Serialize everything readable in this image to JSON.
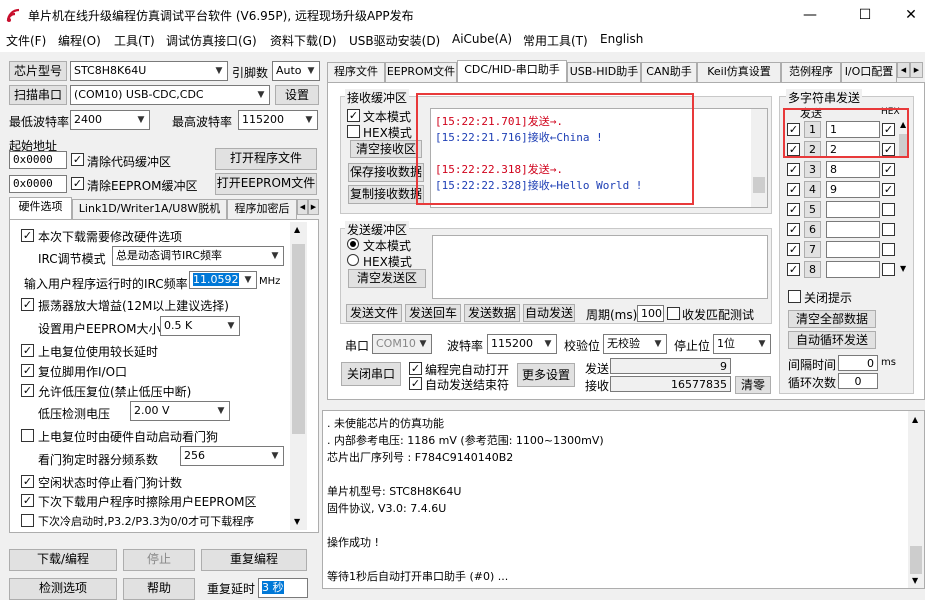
{
  "window": {
    "title": "单片机在线升级编程仿真调试平台软件 (V6.95P), 远程现场升级APP发布",
    "minimize": "—",
    "maximize": "☐",
    "close": "✕"
  },
  "menu": [
    "文件(F)",
    "编程(O)",
    "工具(T)",
    "调试仿真接口(G)",
    "资料下载(D)",
    "USB驱动安装(D)",
    "AiCube(A)",
    "常用工具(T)",
    "English"
  ],
  "left": {
    "chip_model_btn": "芯片型号",
    "chip_model": "STC8H8K64U",
    "pin_label": "引脚数",
    "pin_value": "Auto",
    "scan_port_btn": "扫描串口",
    "port_value": "(COM10) USB-CDC,CDC",
    "settings_btn": "设置",
    "min_baud_label": "最低波特率",
    "min_baud": "2400",
    "max_baud_label": "最高波特率",
    "max_baud": "115200",
    "start_addr_label": "起始地址",
    "addr1": "0x0000",
    "clear_code_buf": "清除代码缓冲区",
    "open_program_btn": "打开程序文件",
    "addr2": "0x0000",
    "clear_eeprom_buf": "清除EEPROM缓冲区",
    "open_eeprom_btn": "打开EEPROM文件",
    "tabs": [
      "硬件选项",
      "Link1D/Writer1A/U8W脱机",
      "程序加密后"
    ],
    "options": {
      "hw_change": "本次下载需要修改硬件选项",
      "irc_mode_label": "IRC调节模式",
      "irc_mode": "总是动态调节IRC频率",
      "irc_freq_label": "输入用户程序运行时的IRC频率",
      "irc_freq": "11.0592",
      "irc_unit": "MHz",
      "osc_gain": "振荡器放大增益(12M以上建议选择)",
      "eeprom_size_label": "设置用户EEPROM大小",
      "eeprom_size": "0.5 K",
      "poweron_delay": "上电复位使用较长延时",
      "reset_pin_io": "复位脚用作I/O口",
      "lvd_reset": "允许低压复位(禁止低压中断)",
      "lvd_voltage_label": "低压检测电压",
      "lvd_voltage": "2.00 V",
      "wdt_auto": "上电复位时由硬件自动启动看门狗",
      "wdt_div_label": "看门狗定时器分频系数",
      "wdt_div": "256",
      "idle_wdt_stop": "空闲状态时停止看门狗计数",
      "erase_eeprom": "下次下载用户程序时擦除用户EEPROM区",
      "next_cold_boot": "下次冷启动时,P3.2/P3.3为0/0才可下载程序"
    },
    "download_btn": "下载/编程",
    "stop_btn": "停止",
    "reprogram_btn": "重复编程",
    "check_btn": "检测选项",
    "help_btn": "帮助",
    "repeat_delay_label": "重复延时",
    "repeat_delay": "3 秒"
  },
  "right": {
    "tabs": [
      "程序文件",
      "EEPROM文件",
      "CDC/HID-串口助手",
      "USB-HID助手",
      "CAN助手",
      "Keil仿真设置",
      "范例程序",
      "I/O口配置"
    ],
    "recv_group": "接收缓冲区",
    "text_mode": "文本模式",
    "hex_mode": "HEX模式",
    "clear_recv_btn": "清空接收区",
    "save_recv_btn": "保存接收数据",
    "copy_recv_btn": "复制接收数据",
    "recv_log": [
      {
        "time": "[15:22:21.701]",
        "text": "发送→.",
        "color": "#d0021b"
      },
      {
        "time": "[15:22:21.716]",
        "text": "接收←China !",
        "color": "#1e3fb5"
      },
      {
        "time": "",
        "text": "",
        "color": "#000000"
      },
      {
        "time": "[15:22:22.318]",
        "text": "发送→.",
        "color": "#d0021b"
      },
      {
        "time": "[15:22:22.328]",
        "text": "接收←Hello World !",
        "color": "#1e3fb5"
      }
    ],
    "send_group": "发送缓冲区",
    "send_text_mode": "文本模式",
    "send_hex_mode": "HEX模式",
    "clear_send_btn": "清空发送区",
    "send_file_btn": "发送文件",
    "send_cr_btn": "发送回车",
    "send_data_btn": "发送数据",
    "auto_send_btn": "自动发送",
    "period_label": "周期(ms)",
    "period_value": "100",
    "recv_match_label": "收发匹配测试",
    "port_label": "串口",
    "port_value": "COM10",
    "baud_label": "波特率",
    "baud_value": "115200",
    "parity_label": "校验位",
    "parity_value": "无校验",
    "stop_label": "停止位",
    "stop_value": "1位",
    "close_port_btn": "关闭串口",
    "auto_open_label": "编程完自动打开",
    "auto_send_end_label": "自动发送结束符",
    "more_settings_btn": "更多设置",
    "send_count_label": "发送",
    "send_count": "9",
    "recv_count_label": "接收",
    "recv_count": "16577835",
    "clear_count_btn": "清零",
    "multi": {
      "title": "多字符串发送",
      "send_col": "发送",
      "hex_col": "HEX",
      "rows": [
        {
          "num": "1",
          "value": "1",
          "checked": true,
          "hex": true
        },
        {
          "num": "2",
          "value": "2",
          "checked": true,
          "hex": true
        },
        {
          "num": "3",
          "value": "8",
          "checked": true,
          "hex": true
        },
        {
          "num": "4",
          "value": "9",
          "checked": true,
          "hex": true
        },
        {
          "num": "5",
          "value": "",
          "checked": true,
          "hex": false
        },
        {
          "num": "6",
          "value": "",
          "checked": true,
          "hex": false
        },
        {
          "num": "7",
          "value": "",
          "checked": true,
          "hex": false
        },
        {
          "num": "8",
          "value": "",
          "checked": true,
          "hex": false
        }
      ],
      "close_hint": "关闭提示",
      "clear_all_btn": "清空全部数据",
      "auto_loop_btn": "自动循环发送",
      "interval_label": "间隔时间",
      "interval_value": "0",
      "interval_unit": "ms",
      "loop_count_label": "循环次数",
      "loop_count": "0"
    },
    "output_log": [
      "  . 未使能芯片的仿真功能",
      "  . 内部参考电压: 1186 mV (参考范围: 1100~1300mV)",
      "芯片出厂序列号 : F784C9140140B2",
      "",
      "  单片机型号: STC8H8K64U",
      "  固件协议, V3.0: 7.4.6U",
      "",
      "操作成功 !",
      "",
      "等待1秒后自动打开串口助手 (#0) ..."
    ]
  }
}
